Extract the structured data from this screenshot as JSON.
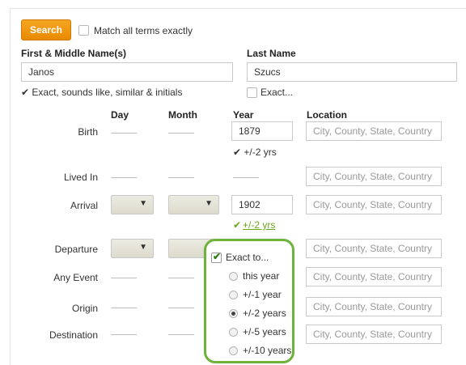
{
  "search": {
    "button_label": "Search",
    "match_all_label": "Match all terms exactly"
  },
  "name": {
    "first_label": "First & Middle Name(s)",
    "first_value": "Janos",
    "first_option": "✔ Exact, sounds like, similar & initials",
    "last_label": "Last Name",
    "last_value": "Szucs",
    "last_exact_label": "Exact..."
  },
  "columns": {
    "day": "Day",
    "month": "Month",
    "year": "Year",
    "location": "Location"
  },
  "events": {
    "birth": {
      "label": "Birth",
      "year": "1879",
      "range": "✔ +/-2 yrs"
    },
    "lived_in": {
      "label": "Lived In"
    },
    "arrival": {
      "label": "Arrival",
      "year": "1902",
      "range_check": "✔",
      "range": "+/-2 yrs"
    },
    "departure": {
      "label": "Departure"
    },
    "any_event": {
      "label": "Any Event"
    },
    "origin": {
      "label": "Origin"
    },
    "destination": {
      "label": "Destination"
    }
  },
  "location_placeholder": "City, County, State, Country",
  "exact_popup": {
    "title": "Exact to...",
    "options": [
      "this year",
      "+/-1 year",
      "+/-2 years",
      "+/-5 years",
      "+/-10 years"
    ],
    "selected_index": 2
  },
  "colors": {
    "accent_orange": "#f5a623",
    "accent_green": "#6fb33a"
  }
}
